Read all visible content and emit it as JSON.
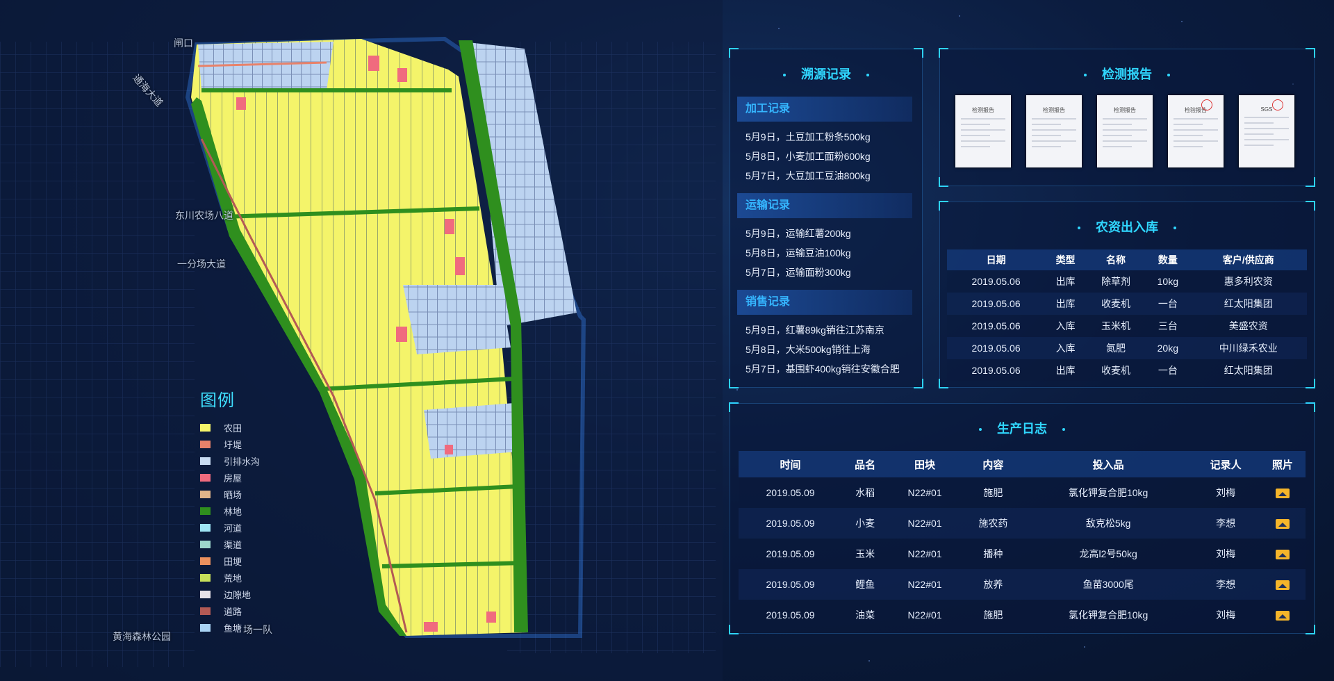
{
  "map": {
    "labels": [
      "闸口",
      "通海大道",
      "东川农场八道",
      "一分场大道",
      "黄海森林公园",
      "场一队"
    ]
  },
  "legend": {
    "title": "图例",
    "items": [
      {
        "label": "农田",
        "color": "#f5f56a"
      },
      {
        "label": "圩堤",
        "color": "#e8826a"
      },
      {
        "label": "引排水沟",
        "color": "#c9dcf2"
      },
      {
        "label": "房屋",
        "color": "#f06b7e"
      },
      {
        "label": "晒场",
        "color": "#e0b48a"
      },
      {
        "label": "林地",
        "color": "#2f8f1e"
      },
      {
        "label": "河道",
        "color": "#9ee4f4"
      },
      {
        "label": "渠道",
        "color": "#9ed8cc"
      },
      {
        "label": "田埂",
        "color": "#ec915e"
      },
      {
        "label": "荒地",
        "color": "#c7df5a"
      },
      {
        "label": "边隙地",
        "color": "#e7e2e8"
      },
      {
        "label": "道路",
        "color": "#b35a55"
      },
      {
        "label": "鱼塘",
        "color": "#a9d3f4"
      }
    ]
  },
  "trace": {
    "title": "溯源记录",
    "sections": [
      {
        "title": "加工记录",
        "lines": [
          "5月9日，土豆加工粉条500kg",
          "5月8日，小麦加工面粉600kg",
          "5月7日，大豆加工豆油800kg"
        ]
      },
      {
        "title": "运输记录",
        "lines": [
          "5月9日，运输红薯200kg",
          "5月8日，运输豆油100kg",
          "5月7日，运输面粉300kg"
        ]
      },
      {
        "title": "销售记录",
        "lines": [
          "5月9日，红薯89kg销往江苏南京",
          "5月8日，大米500kg销往上海",
          "5月7日，基围虾400kg销往安徽合肥"
        ]
      }
    ]
  },
  "reports": {
    "title": "检测报告",
    "items": [
      {
        "label": "检测报告"
      },
      {
        "label": "检测报告"
      },
      {
        "label": "检测报告"
      },
      {
        "label": "检验报告"
      },
      {
        "label": "SGS"
      }
    ]
  },
  "inventory": {
    "title": "农资出入库",
    "headers": [
      "日期",
      "类型",
      "名称",
      "数量",
      "客户/供应商"
    ],
    "rows": [
      [
        "2019.05.06",
        "出库",
        "除草剂",
        "10kg",
        "惠多利农资"
      ],
      [
        "2019.05.06",
        "出库",
        "收麦机",
        "一台",
        "红太阳集团"
      ],
      [
        "2019.05.06",
        "入库",
        "玉米机",
        "三台",
        "美盛农资"
      ],
      [
        "2019.05.06",
        "入库",
        "氮肥",
        "20kg",
        "中川绿禾农业"
      ],
      [
        "2019.05.06",
        "出库",
        "收麦机",
        "一台",
        "红太阳集团"
      ]
    ]
  },
  "log": {
    "title": "生产日志",
    "headers": [
      "时间",
      "品名",
      "田块",
      "内容",
      "投入品",
      "记录人",
      "照片"
    ],
    "rows": [
      [
        "2019.05.09",
        "水稻",
        "N22#01",
        "施肥",
        "氯化钾复合肥10kg",
        "刘梅"
      ],
      [
        "2019.05.09",
        "小麦",
        "N22#01",
        "施农药",
        "敌克松5kg",
        "李想"
      ],
      [
        "2019.05.09",
        "玉米",
        "N22#01",
        "播种",
        "龙高l2号50kg",
        "刘梅"
      ],
      [
        "2019.05.09",
        "鲤鱼",
        "N22#01",
        "放养",
        "鱼苗3000尾",
        "李想"
      ],
      [
        "2019.05.09",
        "油菜",
        "N22#01",
        "施肥",
        "氯化钾复合肥10kg",
        "刘梅"
      ]
    ],
    "photo_icon": "image-icon"
  }
}
